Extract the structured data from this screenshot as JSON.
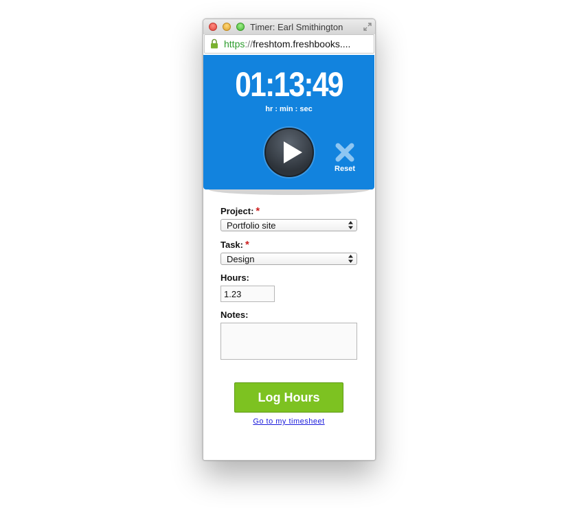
{
  "window": {
    "title": "Timer: Earl Smithington",
    "url_scheme": "https",
    "url_separator": "://",
    "url_rest": "freshtom.freshbooks...."
  },
  "timer": {
    "display": "01:13:49",
    "units": "hr : min : sec",
    "play_icon": "play-icon",
    "reset_label": "Reset",
    "reset_icon": "close-x-icon",
    "panel_color": "#1283de"
  },
  "form": {
    "project_label": "Project:",
    "project_value": "Portfolio site",
    "task_label": "Task:",
    "task_value": "Design",
    "hours_label": "Hours:",
    "hours_value": "1.23",
    "notes_label": "Notes:",
    "notes_value": "",
    "required_marker": "*",
    "required_color": "#cc1f1f"
  },
  "actions": {
    "log_label": "Log Hours",
    "log_color": "#7dc221",
    "timesheet_link": "Go to my timesheet"
  }
}
